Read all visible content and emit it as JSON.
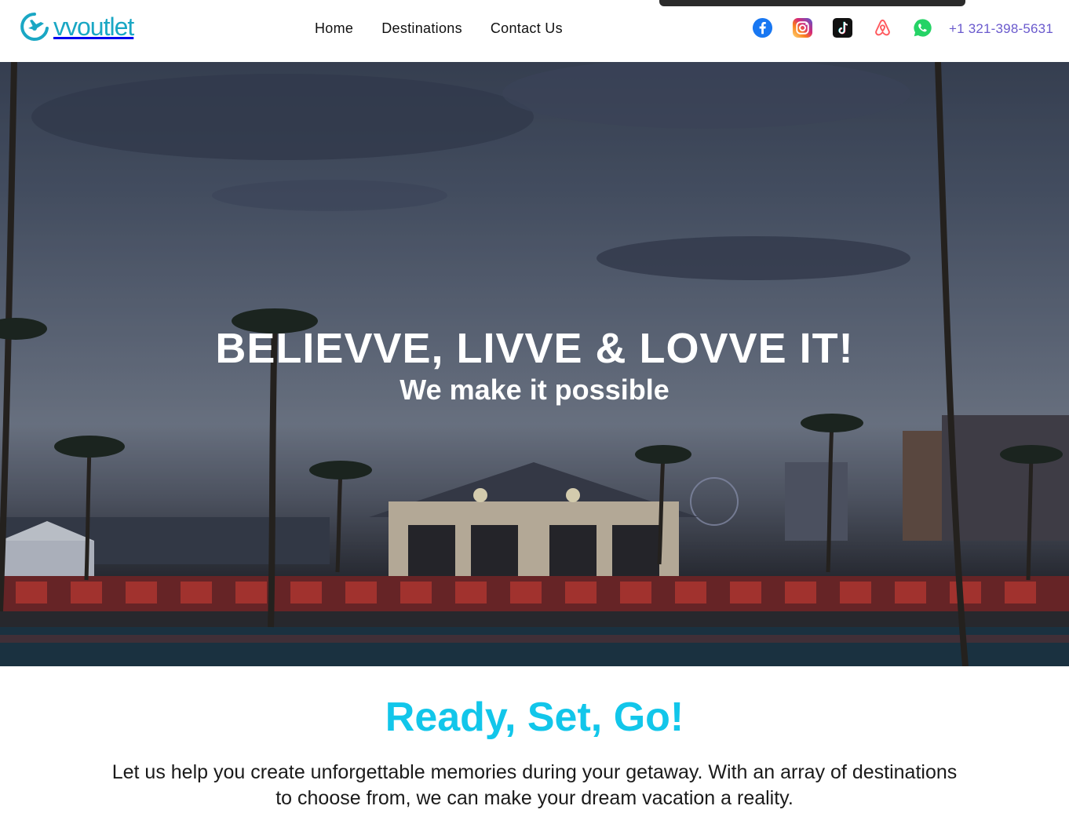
{
  "brand": {
    "logo_text": "vvoutlet",
    "accent": "#1aa7c4"
  },
  "nav": {
    "items": [
      {
        "label": "Home"
      },
      {
        "label": "Destinations"
      },
      {
        "label": "Contact Us"
      }
    ]
  },
  "socials": [
    {
      "name": "facebook-icon",
      "color": "#1877f2"
    },
    {
      "name": "instagram-icon",
      "color": "#e1306c"
    },
    {
      "name": "tiktok-icon",
      "color": "#111111"
    },
    {
      "name": "airbnb-icon",
      "color": "#ff5a5f"
    },
    {
      "name": "whatsapp-icon",
      "color": "#25d366"
    }
  ],
  "contact": {
    "phone": "+1 321-398-5631",
    "color": "#6a5acd"
  },
  "hero": {
    "title": "BELIEVVE, LIVVE & LOVVE IT!",
    "subtitle": "We make it possible"
  },
  "intro": {
    "title": "Ready, Set, Go!",
    "title_color": "#12c6ea",
    "text": "Let us help you create unforgettable memories during your getaway. With an array of destinations to choose from, we can make your dream vacation a reality."
  }
}
